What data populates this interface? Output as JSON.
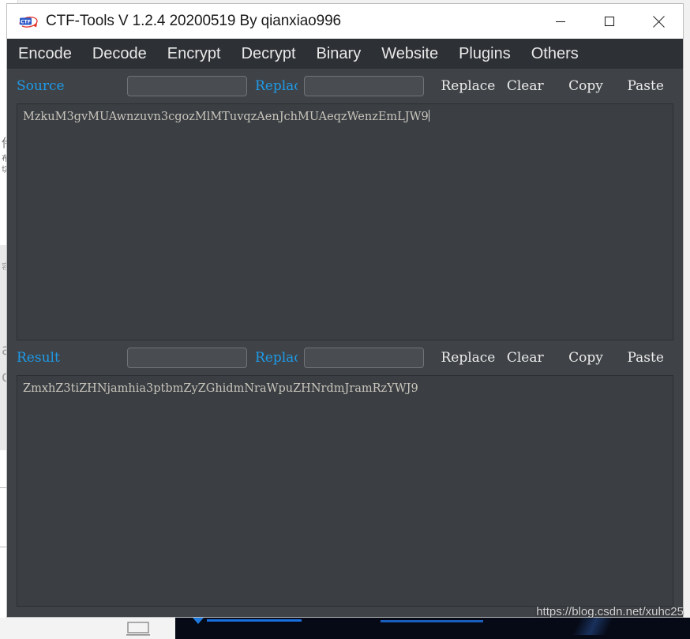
{
  "window": {
    "title": "CTF-Tools V 1.2.4 20200519 By qianxiao996",
    "icon": "ctf-app-icon",
    "controls": {
      "minimize": "—",
      "maximize": "□",
      "close": "✕"
    },
    "accent_blue": "#1e9ae8",
    "titlebar_bg": "#ffffff",
    "menubar_bg": "#2d3034",
    "body_bg": "#3f4347",
    "editor_bg": "#3b3f43"
  },
  "menu": {
    "items": [
      {
        "label": "Encode"
      },
      {
        "label": "Decode"
      },
      {
        "label": "Encrypt"
      },
      {
        "label": "Decrypt"
      },
      {
        "label": "Binary"
      },
      {
        "label": "Website"
      },
      {
        "label": "Plugins"
      },
      {
        "label": "Others"
      }
    ]
  },
  "source_pane": {
    "label": "Source",
    "find_value": "",
    "find_placeholder": "",
    "replace_label": "Replace",
    "replace_value": "",
    "replace_placeholder": "",
    "buttons": {
      "replace": "Replace",
      "clear": "Clear",
      "copy": "Copy",
      "paste": "Paste"
    },
    "text": "MzkuM3gvMUAwnzuvn3cgozMlMTuvqzAenJchMUAeqzWenzEmLJW9"
  },
  "result_pane": {
    "label": "Result",
    "find_value": "",
    "find_placeholder": "",
    "replace_label": "Replace",
    "replace_value": "",
    "replace_placeholder": "",
    "buttons": {
      "replace": "Replace",
      "clear": "Clear",
      "copy": "Copy",
      "paste": "Paste"
    },
    "text": "ZmxhZ3tiZHNjamhia3ptbmZyZGhidmNraWpuZHNrdmJramRzYWJ9"
  },
  "watermark": {
    "text": "https://blog.csdn.net/xuhc25"
  },
  "background": {
    "sliver_chars": [
      "件",
      "布",
      "切",
      "容",
      "a",
      "on"
    ],
    "icon": "monitor-icon"
  }
}
